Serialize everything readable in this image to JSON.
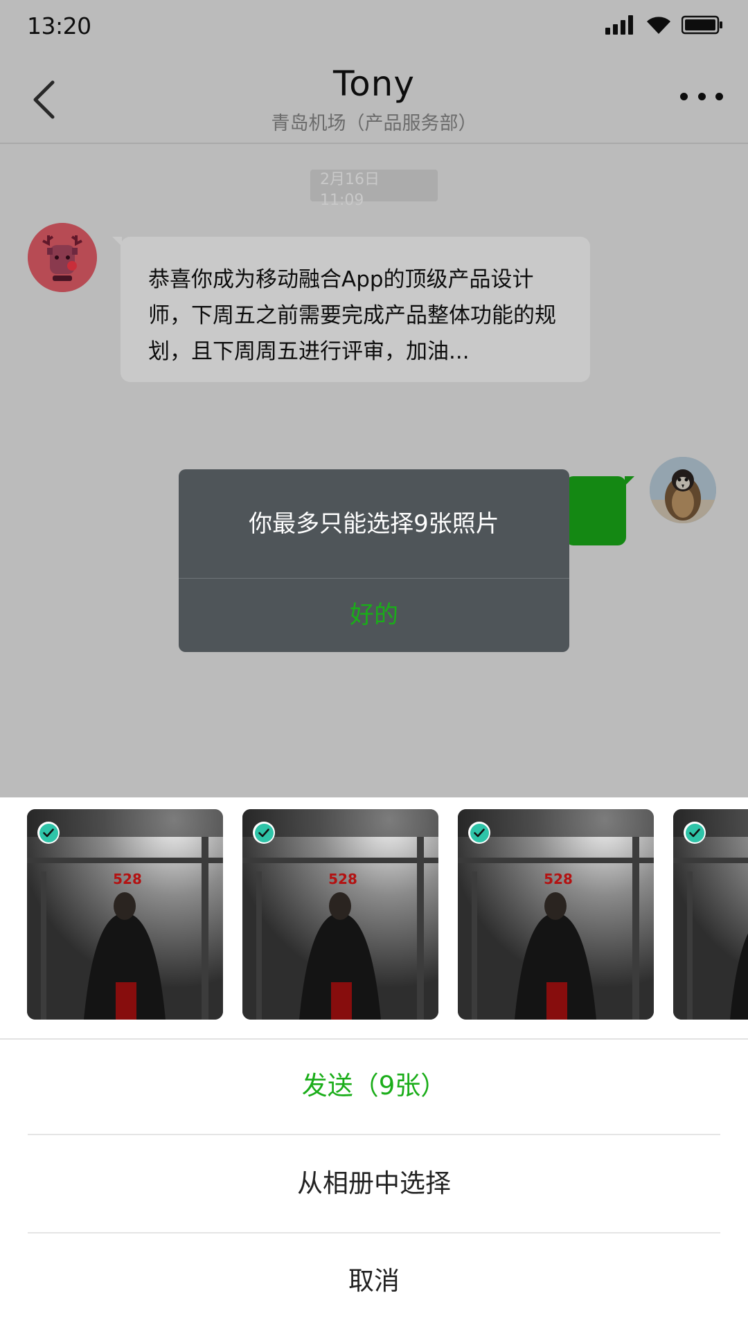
{
  "status_bar": {
    "time": "13:20",
    "icons": [
      "signal-icon",
      "wifi-icon",
      "battery-icon"
    ]
  },
  "header": {
    "back_icon": "chevron-left-icon",
    "title": "Tony",
    "subtitle": "青岛机场（产品服务部）",
    "more_icon": "more-icon"
  },
  "chat": {
    "timestamp_date": "2月16日",
    "timestamp_time": "11:09",
    "messages": [
      {
        "from": "Tony",
        "avatar_icon": "reindeer-avatar",
        "text": "恭喜你成为移动融合App的顶级产品设计师，下周五之前需要完成产品整体功能的规划，且下周周五进行评审，加油..."
      },
      {
        "from": "me",
        "avatar_icon": "penguin-avatar",
        "text": ""
      }
    ]
  },
  "alert": {
    "message": "你最多只能选择9张照片",
    "ok_label": "好的"
  },
  "sheet": {
    "photos": [
      {
        "caption": "528",
        "selected": true
      },
      {
        "caption": "528",
        "selected": true
      },
      {
        "caption": "528",
        "selected": true
      },
      {
        "caption": "528",
        "selected": true
      }
    ],
    "send_label": "发送（9张）",
    "album_label": "从相册中选择",
    "cancel_label": "取消"
  },
  "colors": {
    "accent_green": "#1aad19",
    "alert_bg": "#4f5559",
    "check_teal": "#2ec4a8"
  }
}
